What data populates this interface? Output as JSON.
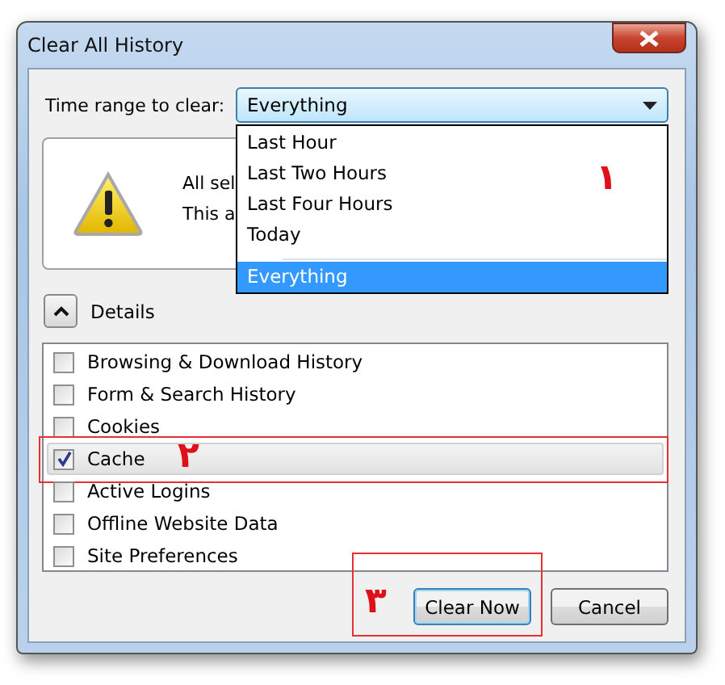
{
  "window": {
    "title": "Clear All History"
  },
  "time_range": {
    "label": "Time range to clear:",
    "value": "Everything",
    "expanded": true,
    "annotation": "١",
    "options": [
      {
        "label": "Last Hour",
        "selected": false
      },
      {
        "label": "Last Two Hours",
        "selected": false
      },
      {
        "label": "Last Four Hours",
        "selected": false
      },
      {
        "label": "Today",
        "selected": false
      },
      {
        "label": "Everything",
        "selected": true
      }
    ]
  },
  "warning": {
    "lines": [
      "All sel",
      "This a"
    ]
  },
  "details": {
    "label": "Details",
    "expanded": true
  },
  "items": [
    {
      "label": "Browsing & Download History",
      "checked": false
    },
    {
      "label": "Form & Search History",
      "checked": false
    },
    {
      "label": "Cookies",
      "checked": false
    },
    {
      "label": "Cache",
      "checked": true,
      "annotation": "٢"
    },
    {
      "label": "Active Logins",
      "checked": false
    },
    {
      "label": "Offline Website Data",
      "checked": false
    },
    {
      "label": "Site Preferences",
      "checked": false
    }
  ],
  "buttons": [
    {
      "label": "Clear Now",
      "default": true,
      "annotation": "٣"
    },
    {
      "label": "Cancel",
      "default": false
    }
  ]
}
